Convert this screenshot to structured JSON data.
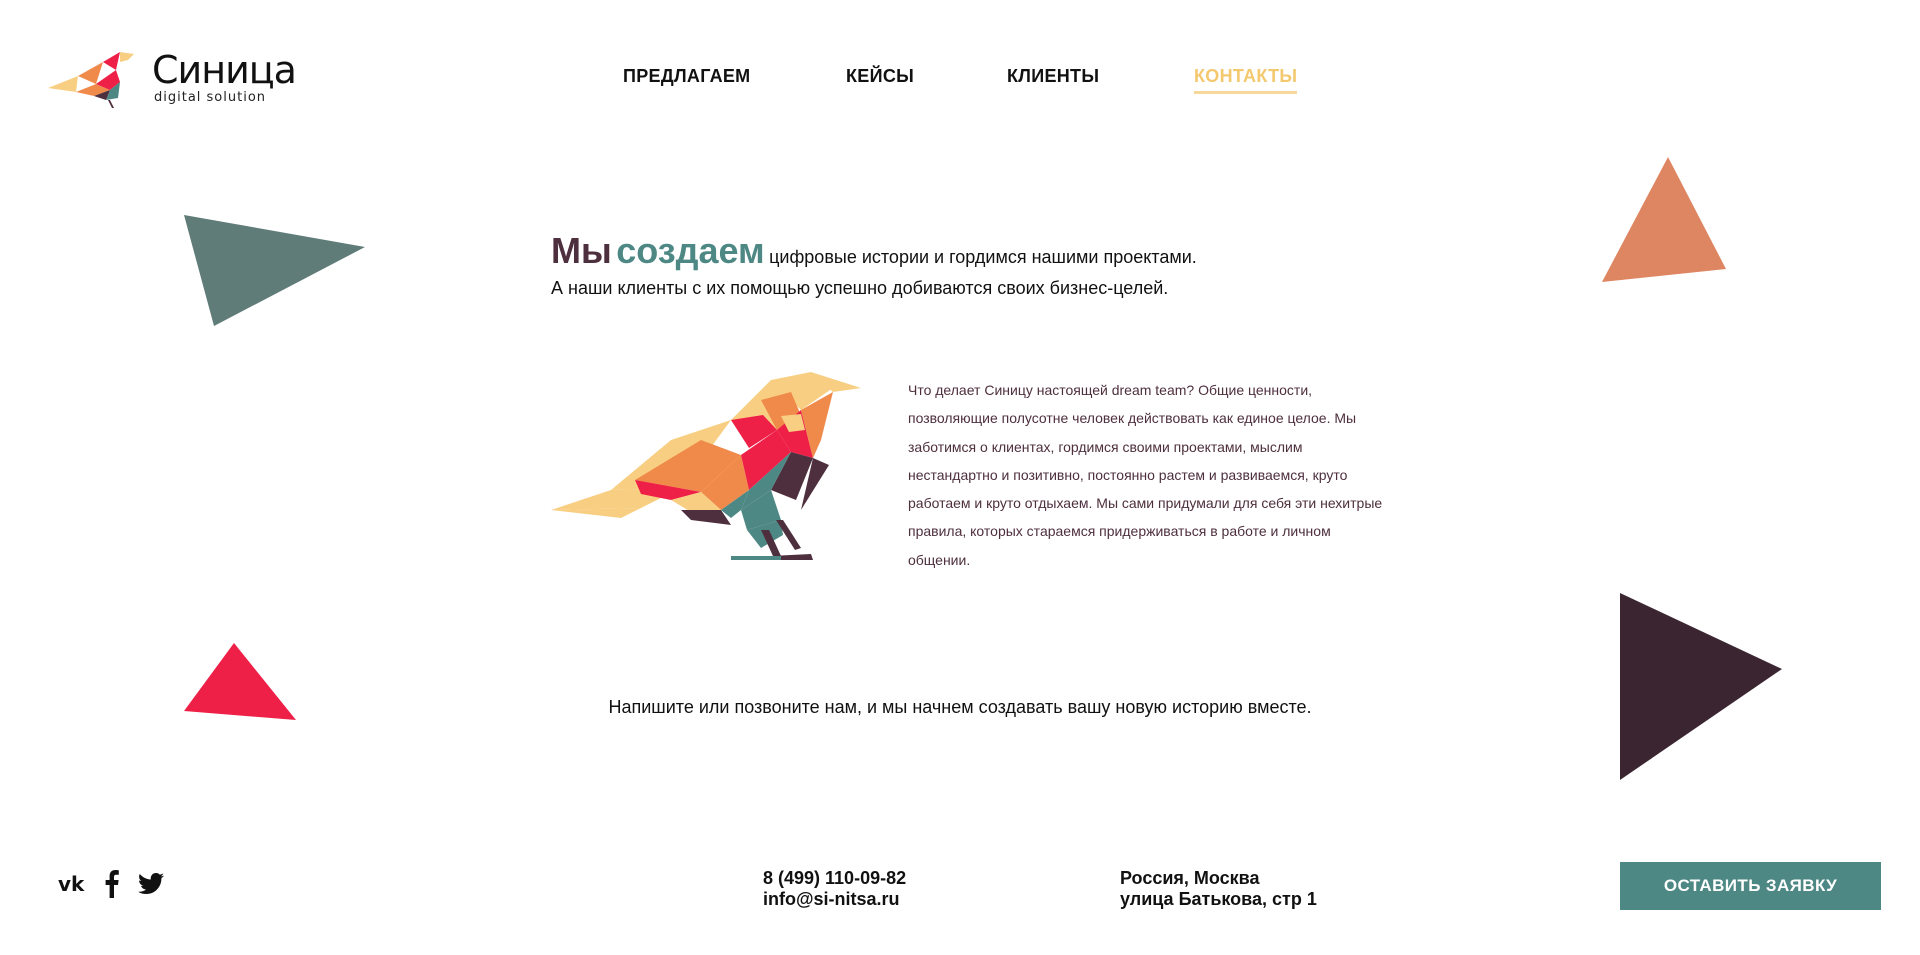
{
  "logo": {
    "name": "Синица",
    "subtitle": "digital solution"
  },
  "nav": [
    {
      "label": "ПРЕДЛАГАЕМ",
      "active": false
    },
    {
      "label": "КЕЙСЫ",
      "active": false
    },
    {
      "label": "КЛИЕНТЫ",
      "active": false
    },
    {
      "label": "КОНТАКТЫ",
      "active": true
    }
  ],
  "headline": {
    "word1": "Мы",
    "word2": "создаем",
    "rest": "цифровые истории и гордимся нашими проектами.",
    "line2": "А наши клиенты с их помощью успешно добиваются своих бизнес-целей."
  },
  "about": "Что делает Синицу настоящей dream team? Общие ценности, позволяющие полусотне человек действовать как единое целое. Мы заботимся о клиентах, гордимся своими проектами, мыслим нестандартно и позитивно, постоянно растем и развиваемся, круто работаем и круто отдыхаем. Мы сами придумали для себя эти нехитрые правила, которых стараемся придерживаться в работе и личном общении.",
  "call_to_action": "Напишите или позвоните нам, и мы начнем создавать вашу новую историю вместе.",
  "social": [
    {
      "icon": "vk-icon",
      "glyph": "vk"
    },
    {
      "icon": "facebook-icon",
      "glyph": "f"
    },
    {
      "icon": "twitter-icon",
      "glyph": "t"
    }
  ],
  "contact": {
    "phone": "8 (499) 110-09-82",
    "email": "info@si-nitsa.ru",
    "city": "Россия, Москва",
    "street": "улица Батькова, стр 1"
  },
  "button": {
    "label": "ОСТАВИТЬ ЗАЯВКУ"
  },
  "colors": {
    "teal": "#4e8884",
    "plum": "#4e2f3d",
    "coral": "#de8662",
    "red": "#ee2048",
    "dark": "#3a2530",
    "gray_teal": "#5f7c79",
    "gold": "#f3c86f"
  }
}
